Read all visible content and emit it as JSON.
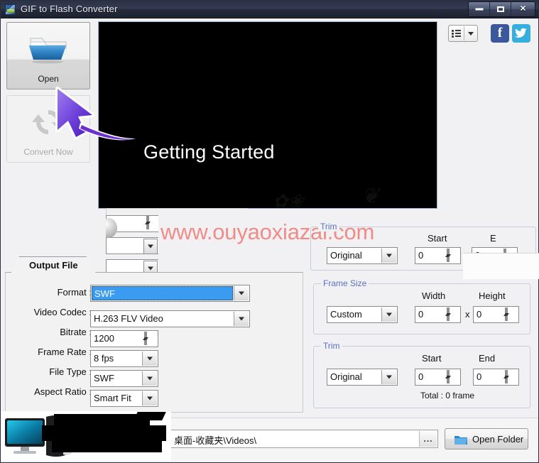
{
  "window": {
    "title": "GIF to Flash Converter",
    "icon": "app-icon",
    "buttons": {
      "minimize": "minimize",
      "maximize": "maximize",
      "close": "✕"
    }
  },
  "sidebar": {
    "buttons": [
      {
        "label": "Open",
        "icon": "folder-open-icon",
        "enabled": true
      },
      {
        "label": "Convert Now",
        "icon": "convert-refresh-icon",
        "enabled": false
      }
    ]
  },
  "preview": {
    "message": "Getting Started"
  },
  "toolbar": {
    "view_button": {
      "icon": "list-view-icon",
      "caret": "chevron-down-icon"
    },
    "social": [
      {
        "name": "facebook",
        "glyph": "f",
        "color": "#3a589b"
      },
      {
        "name": "twitter",
        "glyph": "bird",
        "color": "#36aee0"
      }
    ]
  },
  "output_file": {
    "tab_label": "Output File",
    "fields": [
      {
        "label": "Format :",
        "value": "SWF",
        "type": "combo",
        "selected": true
      },
      {
        "label": "Video Codec :",
        "value": "H.263 FLV Video",
        "type": "combo",
        "selected": false
      },
      {
        "label": "Bitrate :",
        "value": "1200",
        "type": "spin"
      },
      {
        "label": "Frame Rate :",
        "value": "8 fps",
        "type": "combo",
        "selected": false
      },
      {
        "label": "File Type :",
        "value": "SWF",
        "type": "combo",
        "selected": false
      },
      {
        "label": "Aspect Ratio :",
        "value": "Smart Fit",
        "type": "combo",
        "selected": false
      }
    ]
  },
  "right_panel": {
    "groups": [
      {
        "title": "Trim",
        "mode": "Original",
        "columns": [
          "Start",
          "E"
        ],
        "values": [
          "0",
          "0"
        ],
        "partially_hidden": true
      },
      {
        "title": "Frame Size",
        "mode": "Custom",
        "columns": [
          "Width",
          "Height"
        ],
        "values": [
          "0",
          "0"
        ],
        "separator": "x"
      },
      {
        "title": "Trim",
        "mode": "Original",
        "columns": [
          "Start",
          "End"
        ],
        "values": [
          "0",
          "0"
        ],
        "total": "Total : 0 frame"
      }
    ]
  },
  "bottom": {
    "output_path": "桌面-收藏夹\\Videos\\",
    "browse_label": "...",
    "open_folder_label": "Open Folder"
  },
  "watermarks": {
    "primary": "www.ouyaoxiazai.com",
    "primary_color": "#f2655e"
  }
}
